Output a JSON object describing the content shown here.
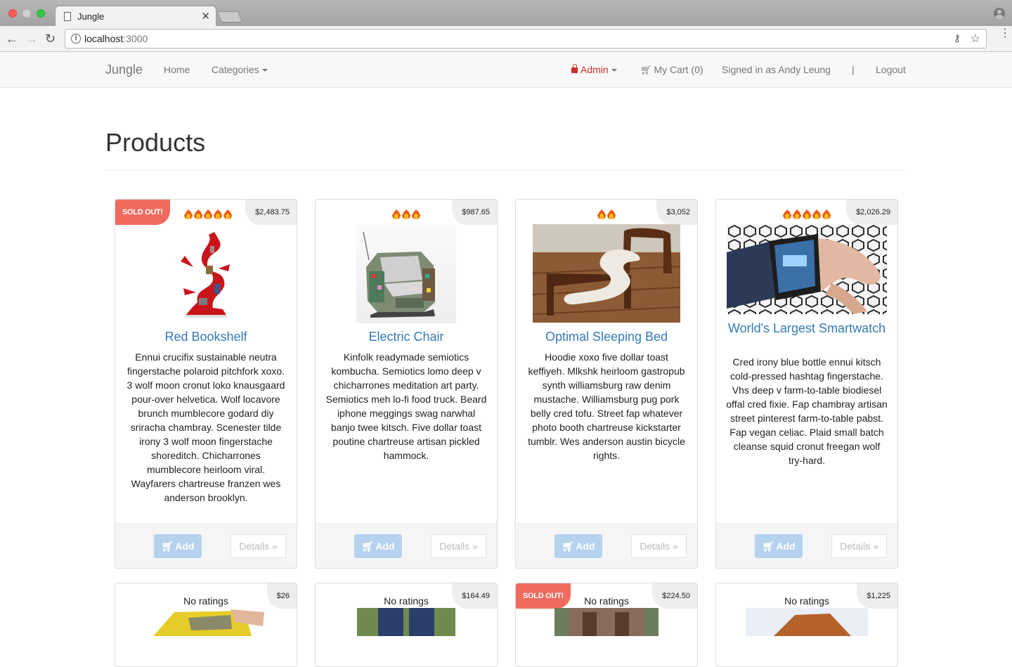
{
  "browser": {
    "tab_title": "Jungle",
    "url_host": "localhost",
    "url_port": ":3000"
  },
  "navbar": {
    "brand": "Jungle",
    "home": "Home",
    "categories": "Categories",
    "admin": "Admin",
    "cart": "My Cart (0)",
    "signed_in": "Signed in as Andy Leung",
    "separator": "|",
    "logout": "Logout"
  },
  "page": {
    "title": "Products"
  },
  "products": [
    {
      "name": "Red Bookshelf",
      "price": "$2,483.75",
      "sold_out": "SOLD OUT!",
      "rating": 5,
      "description": "Ennui crucifix sustainable neutra fingerstache polaroid pitchfork xoxo. 3 wolf moon cronut loko knausgaard pour-over helvetica. Wolf locavore brunch mumblecore godard diy sriracha chambray. Scenester tilde irony 3 wolf moon fingerstache shoreditch. Chicharrones mumblecore heirloom viral. Wayfarers chartreuse franzen wes anderson brooklyn.",
      "add": "Add",
      "details": "Details »"
    },
    {
      "name": "Electric Chair",
      "price": "$987.65",
      "rating": 3,
      "description": "Kinfolk readymade semiotics kombucha. Semiotics lomo deep v chicharrones meditation art party. Semiotics meh lo-fi food truck. Beard iphone meggings swag narwhal banjo twee kitsch. Five dollar toast poutine chartreuse artisan pickled hammock.",
      "add": "Add",
      "details": "Details »"
    },
    {
      "name": "Optimal Sleeping Bed",
      "price": "$3,052",
      "rating": 2,
      "description": "Hoodie xoxo five dollar toast keffiyeh. Mlkshk heirloom gastropub synth williamsburg raw denim mustache. Williamsburg pug pork belly cred tofu. Street fap whatever photo booth chartreuse kickstarter tumblr. Wes anderson austin bicycle rights.",
      "add": "Add",
      "details": "Details »"
    },
    {
      "name": "World's Largest Smartwatch",
      "price": "$2,026.29",
      "rating": 5,
      "description": "Cred irony blue bottle ennui kitsch cold-pressed hashtag fingerstache. Vhs deep v farm-to-table biodiesel offal cred fixie. Fap chambray artisan street pinterest farm-to-table pabst. Fap vegan celiac. Plaid small batch cleanse squid cronut freegan wolf try-hard.",
      "add": "Add",
      "details": "Details »"
    }
  ],
  "products_row2": [
    {
      "price": "$26",
      "rating_text": "No ratings"
    },
    {
      "price": "$164.49",
      "rating_text": "No ratings"
    },
    {
      "price": "$224.50",
      "rating_text": "No ratings",
      "sold_out": "SOLD OUT!"
    },
    {
      "price": "$1,225",
      "rating_text": "No ratings"
    }
  ],
  "icons": {
    "rating": "fire-icon",
    "cart": "shopping-cart-icon",
    "admin": "lock-icon"
  },
  "colors": {
    "link": "#337ab7",
    "soldout": "#f06b5d",
    "admin": "#c9302c",
    "add_button": "#b5d3ef"
  }
}
